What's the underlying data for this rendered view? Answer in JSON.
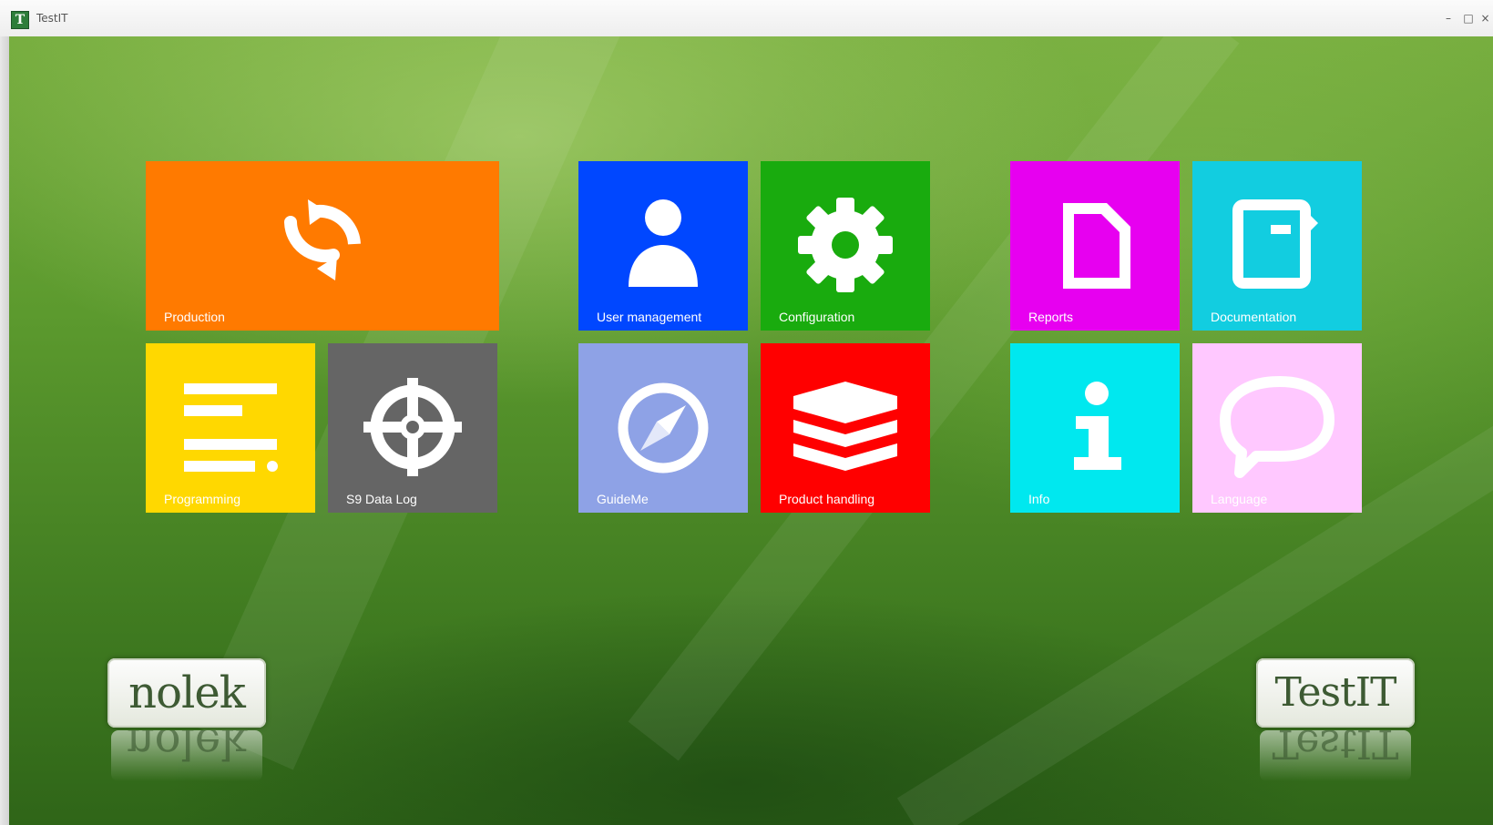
{
  "window": {
    "title": "TestIT",
    "icon_letter": "T",
    "minimize_glyph": "–",
    "maximize_glyph": "□",
    "close_glyph": "×"
  },
  "tiles": {
    "production": {
      "label": "Production",
      "color": "#ff7a00",
      "icon": "refresh-icon"
    },
    "programming": {
      "label": "Programming",
      "color": "#ffd800",
      "icon": "list-icon"
    },
    "s9_data_log": {
      "label": "S9 Data Log",
      "color": "#656565",
      "icon": "target-icon"
    },
    "user_management": {
      "label": "User management",
      "color": "#0047ff",
      "icon": "user-icon"
    },
    "configuration": {
      "label": "Configuration",
      "color": "#19ab0e",
      "icon": "gear-icon"
    },
    "guideme": {
      "label": "GuideMe",
      "color": "#8ea2e6",
      "icon": "compass-icon"
    },
    "product_handling": {
      "label": "Product handling",
      "color": "#ff0000",
      "icon": "layers-icon"
    },
    "reports": {
      "label": "Reports",
      "color": "#e700f0",
      "icon": "document-icon"
    },
    "documentation": {
      "label": "Documentation",
      "color": "#12cde0",
      "icon": "notebook-icon"
    },
    "info": {
      "label": "Info",
      "color": "#00e8ef",
      "icon": "info-icon"
    },
    "language": {
      "label": "Language",
      "color": "#ffc8ff",
      "icon": "speech-bubble-icon"
    }
  },
  "logos": {
    "nolek": "nolek",
    "testit": "TestIT"
  }
}
